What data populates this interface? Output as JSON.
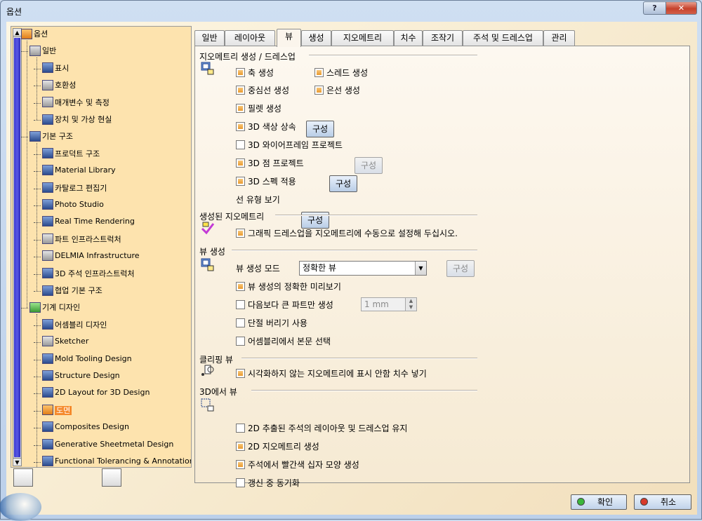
{
  "window": {
    "title": "옵션",
    "help_label": "?",
    "close_label": "✕"
  },
  "tree": {
    "items": [
      {
        "label": "옵션",
        "icon": "options-icon"
      },
      {
        "label": "일반",
        "icon": "general-icon"
      },
      {
        "label": "표시",
        "icon": "display-icon"
      },
      {
        "label": "호환성",
        "icon": "compatibility-icon"
      },
      {
        "label": "매개변수 및 측정",
        "icon": "parameters-icon"
      },
      {
        "label": "장치 및 가상 현실",
        "icon": "devices-icon"
      },
      {
        "label": "기본 구조",
        "icon": "infrastructure-icon"
      },
      {
        "label": "프로덕트 구조",
        "icon": "product-icon"
      },
      {
        "label": "Material Library",
        "icon": "material-icon"
      },
      {
        "label": "카탈로그 편집기",
        "icon": "catalog-icon"
      },
      {
        "label": "Photo Studio",
        "icon": "photo-icon"
      },
      {
        "label": "Real Time Rendering",
        "icon": "rendering-icon"
      },
      {
        "label": "파트 인프라스트럭처",
        "icon": "part-icon"
      },
      {
        "label": "DELMIA Infrastructure",
        "icon": "delmia-icon"
      },
      {
        "label": "3D 주석 인프라스트럭처",
        "icon": "annotation-icon"
      },
      {
        "label": "협업 기본 구조",
        "icon": "collab-icon"
      },
      {
        "label": "기계 디자인",
        "icon": "mechanical-icon"
      },
      {
        "label": "어셈블리 디자인",
        "icon": "assembly-icon"
      },
      {
        "label": "Sketcher",
        "icon": "sketcher-icon"
      },
      {
        "label": "Mold Tooling Design",
        "icon": "mold-icon"
      },
      {
        "label": "Structure Design",
        "icon": "structure-icon"
      },
      {
        "label": "2D Layout for 3D Design",
        "icon": "layout-icon"
      },
      {
        "label": "도면",
        "icon": "drawing-icon"
      },
      {
        "label": "Composites Design",
        "icon": "composites-icon"
      },
      {
        "label": "Generative Sheetmetal Design",
        "icon": "sheetmetal-icon"
      },
      {
        "label": "Functional Tolerancing & Annotation",
        "icon": "tolerancing-icon"
      }
    ],
    "selected_index": 22
  },
  "tabs": [
    {
      "label": "일반"
    },
    {
      "label": "레이아웃"
    },
    {
      "label": "뷰"
    },
    {
      "label": "생성"
    },
    {
      "label": "지오메트리"
    },
    {
      "label": "치수"
    },
    {
      "label": "조작기"
    },
    {
      "label": "주석 및 드레스업"
    },
    {
      "label": "관리"
    }
  ],
  "active_tab": 2,
  "sections": {
    "geometry_gen": {
      "title": "지오메트리 생성 / 드레스업",
      "axis": {
        "label": "축 생성",
        "checked": true
      },
      "thread": {
        "label": "스레드 생성",
        "checked": true
      },
      "center_line": {
        "label": "중심선 생성",
        "checked": true
      },
      "hidden_line": {
        "label": "은선 생성",
        "checked": true
      },
      "fillet": {
        "label": "필렛 생성",
        "checked": true,
        "button": "구성"
      },
      "color_inherit": {
        "label": "3D 색상 상속",
        "checked": true
      },
      "wireframe": {
        "label": "3D 와이어프레임 프로젝트",
        "checked": false,
        "button": "구성"
      },
      "points": {
        "label": "3D 점 프로젝트",
        "checked": true,
        "button": "구성"
      },
      "spec": {
        "label": "3D 스펙 적용",
        "checked": true
      },
      "line_type": {
        "label": "선 유형 보기",
        "button": "구성"
      }
    },
    "generated_geometry": {
      "title": "생성된 지오메트리",
      "manual": {
        "label": "그래픽 드레스업을 지오메트리에 수동으로 설정해 두십시오.",
        "checked": true
      }
    },
    "view_gen": {
      "title": "뷰 생성",
      "mode_label": "뷰 생성 모드",
      "mode_value": "정확한 뷰",
      "mode_button": "구성",
      "preview": {
        "label": "뷰 생성의 정확한 미리보기",
        "checked": true
      },
      "large_parts": {
        "label": "다음보다 큰 파트만 생성",
        "checked": false,
        "value": "1 mm"
      },
      "breakout": {
        "label": "단절 버리기 사용",
        "checked": false
      },
      "assembly_body": {
        "label": "어셈블리에서 본문 선택",
        "checked": false
      }
    },
    "clipping": {
      "title": "클리핑 뷰",
      "dims": {
        "label": "시각화하지 않는 지오메트리에 표시 안함 치수 넣기",
        "checked": true
      }
    },
    "from3d": {
      "title": "3D에서 뷰",
      "keep_layout": {
        "label": "2D 추출된 주석의 레이아웃 및 드레스업 유지",
        "checked": false
      },
      "gen_2d": {
        "label": "2D 지오메트리 생성",
        "checked": true
      },
      "red_cross": {
        "label": "주석에서 빨간색 십자 모양 생성",
        "checked": true
      },
      "sync": {
        "label": "갱신 중 동기화",
        "checked": false
      }
    }
  },
  "footer": {
    "ok": "확인",
    "cancel": "취소"
  },
  "colors": {
    "ok_dot": "#3bb83b",
    "cancel_dot": "#d83a2a",
    "selected": "#f58a2c"
  }
}
